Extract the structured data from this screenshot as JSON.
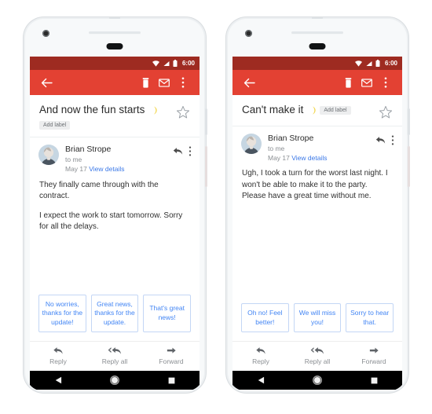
{
  "phones": [
    {
      "id": "left",
      "statusbar": {
        "time": "6:00",
        "icons": [
          "wifi-icon",
          "signal-icon",
          "battery-icon"
        ]
      },
      "toolbar": {
        "back": "back-arrow-icon",
        "delete": "trash-icon",
        "mark_unread": "envelope-icon",
        "overflow": "more-vertical-icon"
      },
      "subject": {
        "text": "And now the fun starts",
        "emoji": "crescent-moon",
        "label": "Add label",
        "label_inline": false,
        "starred": false
      },
      "sender": {
        "name": "Brian Strope",
        "to": "to me",
        "date": "May 17",
        "details_link": "View details"
      },
      "body": [
        "They finally came through with the contract.",
        "I expect the work to start tomorrow. Sorry for all the delays."
      ],
      "smart_replies": [
        "No worries, thanks for the update!",
        "Great news, thanks for the update.",
        "That's great news!"
      ],
      "actions": [
        {
          "icon": "reply-icon",
          "label": "Reply"
        },
        {
          "icon": "reply-all-icon",
          "label": "Reply all"
        },
        {
          "icon": "forward-icon",
          "label": "Forward"
        }
      ],
      "navbar": [
        "back-triangle-icon",
        "home-circle-icon",
        "recents-square-icon"
      ]
    },
    {
      "id": "right",
      "statusbar": {
        "time": "6:00",
        "icons": [
          "wifi-icon",
          "signal-icon",
          "battery-icon"
        ]
      },
      "toolbar": {
        "back": "back-arrow-icon",
        "delete": "trash-icon",
        "mark_unread": "envelope-icon",
        "overflow": "more-vertical-icon"
      },
      "subject": {
        "text": "Can't make it",
        "emoji": "crescent-moon",
        "label": "Add label",
        "label_inline": true,
        "starred": false
      },
      "sender": {
        "name": "Brian Strope",
        "to": "to me",
        "date": "May 17",
        "details_link": "View details"
      },
      "body": [
        "Ugh, I took a turn for the worst last night. I won't be able to make it to the party. Please have a great time without me."
      ],
      "smart_replies": [
        "Oh no! Feel better!",
        "We will miss you!",
        "Sorry to hear that."
      ],
      "actions": [
        {
          "icon": "reply-icon",
          "label": "Reply"
        },
        {
          "icon": "reply-all-icon",
          "label": "Reply all"
        },
        {
          "icon": "forward-icon",
          "label": "Forward"
        }
      ],
      "navbar": [
        "back-triangle-icon",
        "home-circle-icon",
        "recents-square-icon"
      ]
    }
  ],
  "colors": {
    "toolbar_red": "#e34133",
    "statusbar_red": "#9e2b21",
    "chip_blue": "#4285f4",
    "chip_border": "#c3d6f5",
    "link_blue": "#3b78e7",
    "moon_yellow": "#f2d64b",
    "muted_text": "#8b8f93",
    "navbar_black": "#000000",
    "phone_body": "#f7f9fa"
  }
}
